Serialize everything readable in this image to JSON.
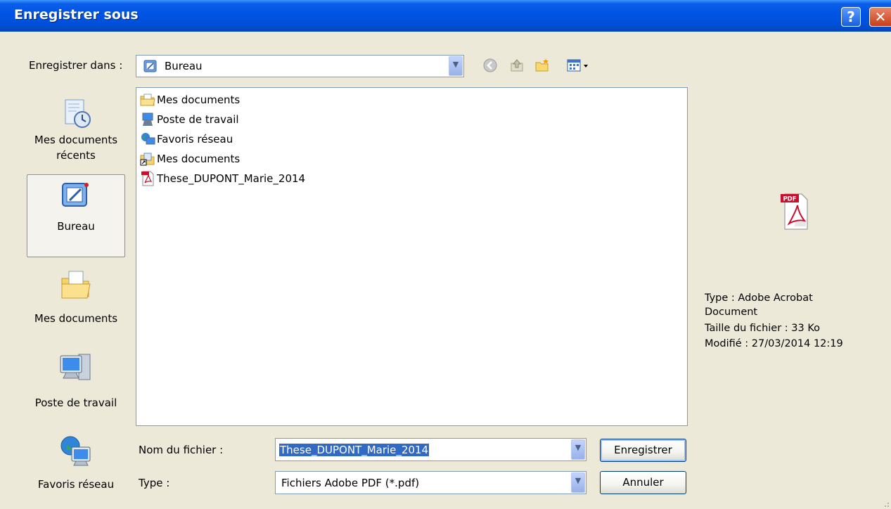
{
  "window": {
    "title": "Enregistrer sous",
    "help_label": "?",
    "close_label": "✕"
  },
  "save_in": {
    "label": "Enregistrer dans :",
    "value": "Bureau"
  },
  "places": [
    {
      "line1": "Mes documents",
      "line2": "récents",
      "icon": "recent-documents-icon"
    },
    {
      "line1": "Bureau",
      "line2": "",
      "icon": "desktop-icon",
      "selected": true
    },
    {
      "line1": "Mes documents",
      "line2": "",
      "icon": "my-documents-icon"
    },
    {
      "line1": "Poste de travail",
      "line2": "",
      "icon": "my-computer-icon"
    },
    {
      "line1": "Favoris réseau",
      "line2": "",
      "icon": "network-places-icon"
    }
  ],
  "files": [
    {
      "name": "Mes documents",
      "icon": "folder-documents-icon"
    },
    {
      "name": "Poste de travail",
      "icon": "computer-icon"
    },
    {
      "name": "Favoris réseau",
      "icon": "network-icon"
    },
    {
      "name": "Mes documents",
      "icon": "folder-shortcut-icon"
    },
    {
      "name": "These_DUPONT_Marie_2014",
      "icon": "pdf-file-icon"
    }
  ],
  "preview": {
    "type_line1": "Type : Adobe Acrobat",
    "type_line2": "Document",
    "size": "Taille du fichier : 33 Ko",
    "modified": "Modifié : 27/03/2014 12:19",
    "badge": "PDF"
  },
  "filename": {
    "label": "Nom du fichier :",
    "value": "These_DUPONT_Marie_2014"
  },
  "filetype": {
    "label": "Type :",
    "value": "Fichiers Adobe PDF (*.pdf)"
  },
  "buttons": {
    "save": "Enregistrer",
    "cancel": "Annuler"
  },
  "colors": {
    "titlebar": "#0054e3",
    "dialog_bg": "#ece9d8",
    "selection": "#316ac5"
  }
}
